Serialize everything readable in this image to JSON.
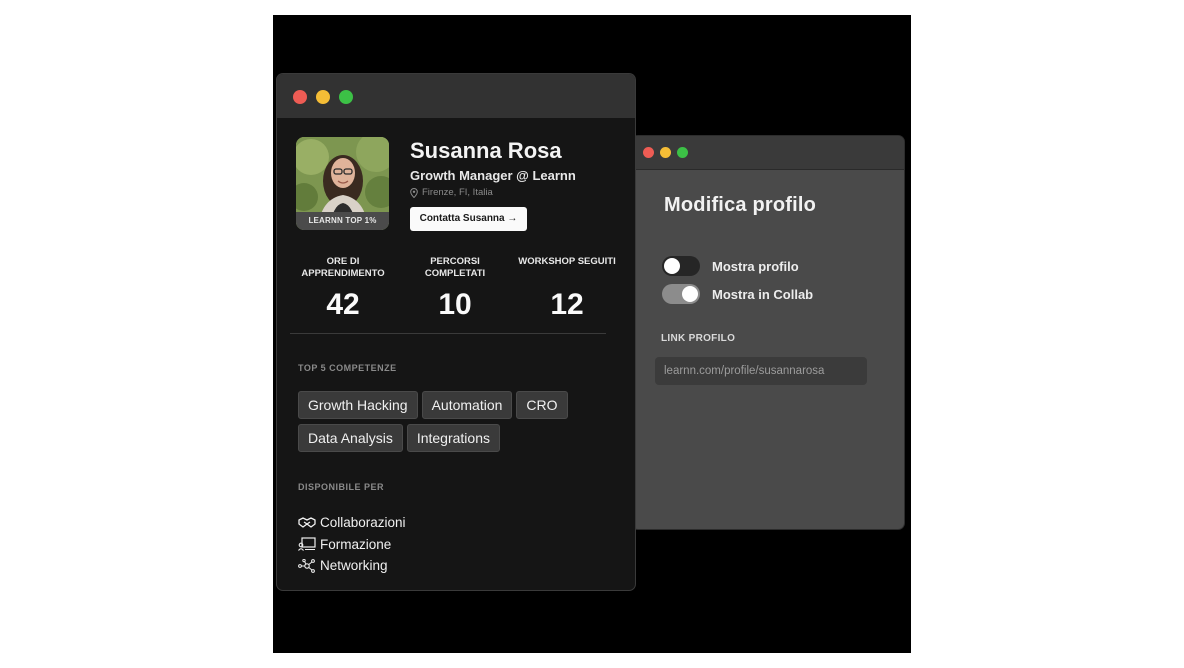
{
  "back_window": {
    "title": "Modifica profilo",
    "toggles": [
      {
        "label": "Mostra profilo",
        "on": false
      },
      {
        "label": "Mostra in Collab",
        "on": true
      }
    ],
    "link_label": "LINK PROFILO",
    "link_value": "learnn.com/profile/susannarosa"
  },
  "profile": {
    "name": "Susanna Rosa",
    "role": "Growth Manager @ Learnn",
    "location": "Firenze, FI, Italia",
    "badge": "LEARNN TOP 1%",
    "contact_button": "Contatta Susanna →"
  },
  "stats": [
    {
      "label": "ORE DI APPRENDIMENTO",
      "value": "42"
    },
    {
      "label": "PERCORSI COMPLETATI",
      "value": "10"
    },
    {
      "label": "WORKSHOP SEGUITI",
      "value": "12"
    }
  ],
  "skills": {
    "title": "TOP 5 COMPETENZE",
    "items": [
      "Growth Hacking",
      "Automation",
      "CRO",
      "Data Analysis",
      "Integrations"
    ]
  },
  "availability": {
    "title": "DISPONIBILE PER",
    "items": [
      {
        "label": "Collaborazioni",
        "icon": "handshake-icon"
      },
      {
        "label": "Formazione",
        "icon": "presentation-icon"
      },
      {
        "label": "Networking",
        "icon": "network-icon"
      }
    ]
  },
  "colors": {
    "close": "#ee5c54",
    "minimize": "#f5bd36",
    "maximize": "#3cc146"
  }
}
